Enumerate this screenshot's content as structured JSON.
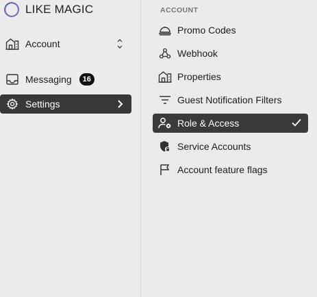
{
  "brand": {
    "name": "LIKE MAGIC"
  },
  "sidebar": {
    "items": [
      {
        "label": "Account",
        "icon": "building-icon"
      },
      {
        "label": "Messaging",
        "icon": "inbox-icon",
        "badge": "16"
      },
      {
        "label": "Settings",
        "icon": "gear-icon",
        "active": true
      }
    ]
  },
  "settings_menu": {
    "section_title": "ACCOUNT",
    "items": [
      {
        "label": "Promo Codes",
        "icon": "cloche-icon"
      },
      {
        "label": "Webhook",
        "icon": "webhook-icon"
      },
      {
        "label": "Properties",
        "icon": "building-icon"
      },
      {
        "label": "Guest Notification Filters",
        "icon": "filter-icon"
      },
      {
        "label": "Role & Access",
        "icon": "user-gear-icon",
        "selected": true
      },
      {
        "label": "Service Accounts",
        "icon": "shield-lock-icon"
      },
      {
        "label": "Account feature flags",
        "icon": "flag-icon"
      }
    ]
  },
  "colors": {
    "active_bg": "#383838",
    "panel_bg": "#ebebeb",
    "badge_bg": "#111111"
  }
}
